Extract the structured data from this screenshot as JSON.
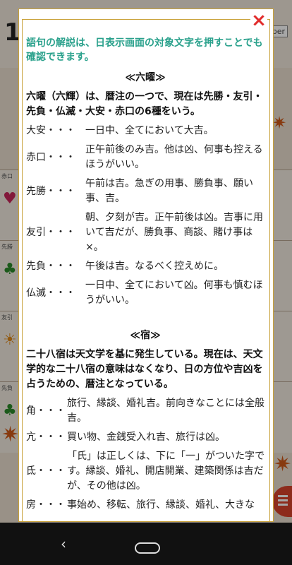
{
  "background": {
    "month": "1",
    "month_en": "ber",
    "row_tags": [
      "赤口",
      "先勝",
      "友引",
      "先負"
    ]
  },
  "dialog": {
    "close_label": "×",
    "notice": "語句の解説は、日表示画面の対象文字を押すことでも確認できます。",
    "rokuyo": {
      "title": "≪六曜≫",
      "intro": "六曜（六輝）は、暦注の一つで、現在は先勝・友引・先負・仏滅・大安・赤口の6種をいう。",
      "entries": [
        {
          "term": "大安・・・",
          "desc": "一日中、全てにおいて大吉。"
        },
        {
          "term": "赤口・・・",
          "desc": "正午前後のみ吉。他は凶、何事も控えるほうがいい。"
        },
        {
          "term": "先勝・・・",
          "desc": "午前は吉。急ぎの用事、勝負事、願い事、吉。"
        },
        {
          "term": "友引・・・",
          "desc": "朝、夕刻が吉。正午前後は凶。吉事に用いて吉だが、勝負事、商談、賭け事は×。"
        },
        {
          "term": "先負・・・",
          "desc": "午後は吉。なるべく控えめに。"
        },
        {
          "term": "仏滅・・・",
          "desc": "一日中、全てにおいて凶。何事も慎むほうがいい。"
        }
      ]
    },
    "shuku": {
      "title": "≪宿≫",
      "intro": "二十八宿は天文学を基に発生している。現在は、天文学的な二十八宿の意味はなくなり、日の方位や吉凶を占うための、暦注となっている。",
      "entries": [
        {
          "term": "角・・・",
          "desc": "旅行、縁談、婚礼吉。前向きなことには全般吉。"
        },
        {
          "term": "亢・・・",
          "desc": "買い物、金銭受入れ吉、旅行は凶。"
        },
        {
          "term": "氐・・・",
          "desc": "「氏」は正しくは、下に「一」がついた字です。縁談、婚礼、開店開業、建築関係は吉だが、その他は凶。"
        },
        {
          "term": "房・・・",
          "desc": "事始め、移転、旅行、縁談、婚礼、大きな"
        }
      ]
    }
  },
  "navbar": {
    "back_label": "‹"
  }
}
